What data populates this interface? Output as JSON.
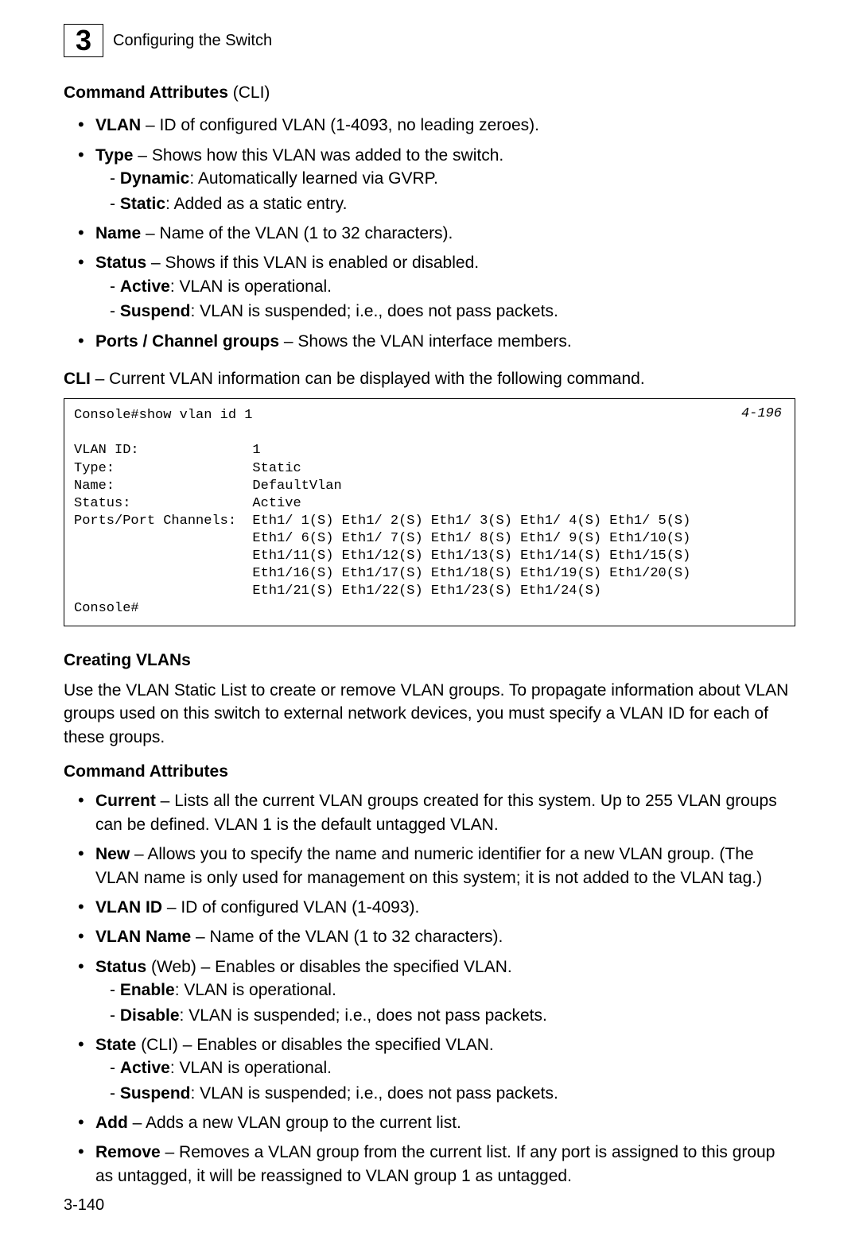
{
  "header": {
    "chapter_number": "3",
    "chapter_title": "Configuring the Switch"
  },
  "section1_title_bold": "Command Attributes",
  "section1_title_normal": " (CLI)",
  "attrs1": {
    "vlan_bold": "VLAN",
    "vlan_text": " – ID of configured VLAN (1-4093, no leading zeroes).",
    "type_bold": "Type",
    "type_text": " – Shows how this VLAN was added to the switch.",
    "type_dynamic_bold": "Dynamic",
    "type_dynamic_text": ": Automatically learned via GVRP.",
    "type_static_bold": "Static",
    "type_static_text": ": Added as a static entry.",
    "name_bold": "Name",
    "name_text": " – Name of the VLAN (1 to 32 characters).",
    "status_bold": "Status",
    "status_text": " – Shows if this VLAN is enabled or disabled.",
    "status_active_bold": "Active",
    "status_active_text": ": VLAN is operational.",
    "status_suspend_bold": "Suspend",
    "status_suspend_text": ": VLAN is suspended; i.e., does not pass packets.",
    "ports_bold": "Ports / Channel groups",
    "ports_text": " – Shows the VLAN interface members."
  },
  "cli_intro_bold": "CLI",
  "cli_intro_text": " – Current VLAN information can be displayed with the following command.",
  "cli_ref": "4-196",
  "cli_output": "Console#show vlan id 1\n\nVLAN ID:              1\nType:                 Static\nName:                 DefaultVlan\nStatus:               Active\nPorts/Port Channels:  Eth1/ 1(S) Eth1/ 2(S) Eth1/ 3(S) Eth1/ 4(S) Eth1/ 5(S)\n                      Eth1/ 6(S) Eth1/ 7(S) Eth1/ 8(S) Eth1/ 9(S) Eth1/10(S)\n                      Eth1/11(S) Eth1/12(S) Eth1/13(S) Eth1/14(S) Eth1/15(S)\n                      Eth1/16(S) Eth1/17(S) Eth1/18(S) Eth1/19(S) Eth1/20(S)\n                      Eth1/21(S) Eth1/22(S) Eth1/23(S) Eth1/24(S)\nConsole#",
  "section2_title": "Creating VLANs",
  "section2_body": "Use the VLAN Static List to create or remove VLAN groups. To propagate information about VLAN groups used on this switch to external network devices, you must specify a VLAN ID for each of these groups.",
  "section3_title": "Command Attributes",
  "attrs2": {
    "current_bold": "Current",
    "current_text": " – Lists all the current VLAN groups created for this system. Up to 255 VLAN groups can be defined. VLAN 1 is the default untagged VLAN.",
    "new_bold": "New",
    "new_text": " – Allows you to specify the name and numeric identifier for a new VLAN group. (The VLAN name is only used for management on this system; it is not added to the VLAN tag.)",
    "vlanid_bold": "VLAN ID",
    "vlanid_text": " – ID of configured VLAN (1-4093).",
    "vlanname_bold": "VLAN Name",
    "vlanname_text": " – Name of the VLAN (1 to 32 characters).",
    "statusweb_bold": "Status",
    "statusweb_paren": " (Web) – Enables or disables the specified VLAN.",
    "statusweb_enable_bold": "Enable",
    "statusweb_enable_text": ": VLAN is operational.",
    "statusweb_disable_bold": "Disable",
    "statusweb_disable_text": ": VLAN is suspended; i.e., does not pass packets.",
    "statecli_bold": "State",
    "statecli_paren": " (CLI) – Enables or disables the specified VLAN.",
    "statecli_active_bold": "Active",
    "statecli_active_text": ": VLAN is operational.",
    "statecli_suspend_bold": "Suspend",
    "statecli_suspend_text": ": VLAN is suspended; i.e., does not pass packets.",
    "add_bold": "Add",
    "add_text": " – Adds a new VLAN group to the current list.",
    "remove_bold": "Remove",
    "remove_text": " – Removes a VLAN group from the current list. If any port is assigned to this group as untagged, it will be reassigned to VLAN group 1 as untagged."
  },
  "page_number": "3-140"
}
